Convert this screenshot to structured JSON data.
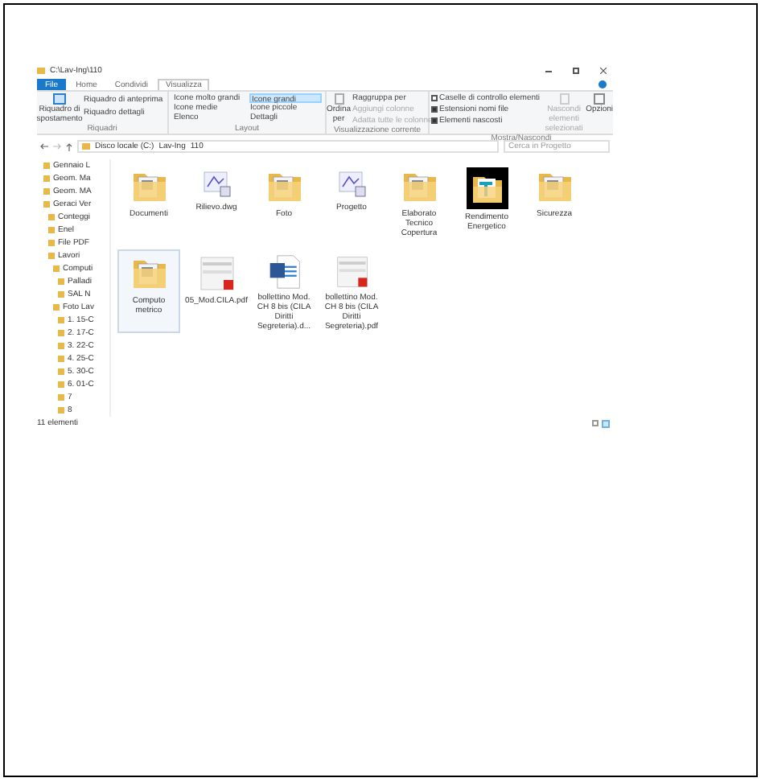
{
  "window": {
    "title": "C:\\Lav-Ing\\110"
  },
  "tabs": [
    {
      "label": "File",
      "selected": false,
      "kind": "file"
    },
    {
      "label": "Home",
      "selected": false,
      "kind": "tab"
    },
    {
      "label": "Condividi",
      "selected": false,
      "kind": "tab"
    },
    {
      "label": "Visualizza",
      "selected": true,
      "kind": "tab"
    }
  ],
  "ribbon": {
    "riquadri": {
      "label": "Riquadri",
      "big": "Riquadro di spostamento",
      "items": [
        "Riquadro di anteprima",
        "Riquadro dettagli"
      ]
    },
    "layout": {
      "label": "Layout",
      "items": [
        {
          "label": "Icone molto grandi",
          "selected": false
        },
        {
          "label": "Icone grandi",
          "selected": true
        },
        {
          "label": "Icone medie",
          "selected": false
        },
        {
          "label": "Icone piccole",
          "selected": false
        },
        {
          "label": "Elenco",
          "selected": false
        },
        {
          "label": "Dettagli",
          "selected": false
        }
      ]
    },
    "view": {
      "label": "Visualizzazione corrente",
      "big": "Ordina per",
      "items": [
        {
          "label": "Raggruppa per",
          "disabled": false
        },
        {
          "label": "Aggiungi colonne",
          "disabled": true
        },
        {
          "label": "Adatta tutte le colonne",
          "disabled": true
        }
      ]
    },
    "show": {
      "label": "Mostra/Nascondi",
      "checks": [
        {
          "label": "Caselle di controllo elementi",
          "checked": false
        },
        {
          "label": "Estensioni nomi file",
          "checked": true
        },
        {
          "label": "Elementi nascosti",
          "checked": true
        }
      ],
      "hide": "Nascondi elementi selezionati",
      "options": "Opzioni"
    }
  },
  "address": {
    "crumbs": [
      "Disco locale (C:)",
      "Lav-Ing",
      "110"
    ],
    "search_placeholder": "Cerca in Progetto"
  },
  "tree": [
    {
      "label": "Gennaio L"
    },
    {
      "label": "Geom. Ma"
    },
    {
      "label": "Geom. MA"
    },
    {
      "label": "Geraci Ver",
      "children": [
        {
          "label": "Conteggi"
        },
        {
          "label": "Enel"
        },
        {
          "label": "File PDF"
        },
        {
          "label": "Lavori",
          "children": [
            {
              "label": "Computi",
              "children": [
                {
                  "label": "Palladi"
                },
                {
                  "label": "SAL N"
                }
              ]
            },
            {
              "label": "Foto Lav",
              "children": [
                {
                  "label": "1. 15-C"
                },
                {
                  "label": "2. 17-C"
                },
                {
                  "label": "3. 22-C"
                },
                {
                  "label": "4. 25-C"
                },
                {
                  "label": "5. 30-C"
                },
                {
                  "label": "6. 01-C"
                },
                {
                  "label": "7"
                },
                {
                  "label": "8"
                }
              ]
            }
          ]
        }
      ]
    }
  ],
  "files": [
    {
      "name": "Documenti",
      "kind": "folder",
      "selected": false
    },
    {
      "name": "Rilievo.dwg",
      "kind": "dwg",
      "selected": false
    },
    {
      "name": "Foto",
      "kind": "folder",
      "selected": false
    },
    {
      "name": "Progetto",
      "kind": "dwg",
      "selected": false
    },
    {
      "name": "Elaborato Tecnico Copertura",
      "kind": "folder",
      "selected": false
    },
    {
      "name": "Rendimento Energetico",
      "kind": "dark",
      "selected": false
    },
    {
      "name": "Sicurezza",
      "kind": "folder",
      "selected": false
    },
    {
      "name": "Computo metrico",
      "kind": "folder",
      "selected": true
    },
    {
      "name": "05_Mod.CILA.pdf",
      "kind": "pdf",
      "selected": false
    },
    {
      "name": "bollettino Mod. CH 8 bis (CILA Diritti Segreteria).d...",
      "kind": "word",
      "selected": false
    },
    {
      "name": "bollettino Mod. CH 8 bis (CILA Diritti Segreteria).pdf",
      "kind": "pdf",
      "selected": false
    }
  ],
  "status": "11 elementi"
}
